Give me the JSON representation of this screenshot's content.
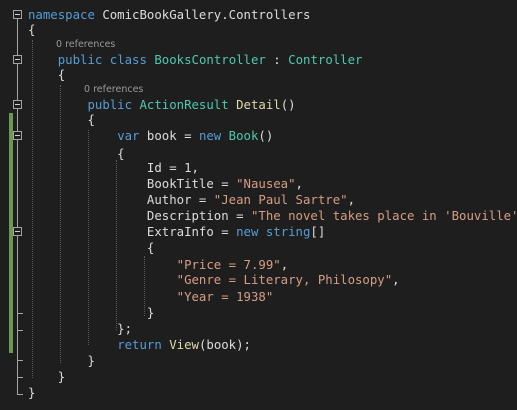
{
  "editor": {
    "language": "C#",
    "colors": {
      "background": "#1e1e1e",
      "keyword": "#569cd6",
      "type": "#4ec9b0",
      "method": "#dcdcaa",
      "string": "#d69d85",
      "plain": "#dcdcdc",
      "codelens": "#999999",
      "change_bar": "#6a9955"
    },
    "codelens": [
      {
        "label": "0 references"
      },
      {
        "label": "0 references"
      }
    ],
    "lines": [
      {
        "tokens": [
          {
            "t": "kw",
            "v": "namespace"
          },
          {
            "t": "pl",
            "v": " ComicBookGallery.Controllers"
          }
        ]
      },
      {
        "tokens": [
          {
            "t": "pl",
            "v": "{"
          }
        ]
      },
      {
        "tokens": [
          {
            "t": "pl",
            "v": "    "
          },
          {
            "t": "kw",
            "v": "public"
          },
          {
            "t": "pl",
            "v": " "
          },
          {
            "t": "kw",
            "v": "class"
          },
          {
            "t": "pl",
            "v": " "
          },
          {
            "t": "ty",
            "v": "BooksController"
          },
          {
            "t": "pl",
            "v": " : "
          },
          {
            "t": "ty",
            "v": "Controller"
          }
        ]
      },
      {
        "tokens": [
          {
            "t": "pl",
            "v": "    {"
          }
        ]
      },
      {
        "tokens": [
          {
            "t": "pl",
            "v": "        "
          },
          {
            "t": "kw",
            "v": "public"
          },
          {
            "t": "pl",
            "v": " "
          },
          {
            "t": "ty",
            "v": "ActionResult"
          },
          {
            "t": "pl",
            "v": " "
          },
          {
            "t": "fn",
            "v": "Detail"
          },
          {
            "t": "pl",
            "v": "()"
          }
        ]
      },
      {
        "tokens": [
          {
            "t": "pl",
            "v": "        {"
          }
        ]
      },
      {
        "tokens": [
          {
            "t": "pl",
            "v": "            "
          },
          {
            "t": "kw",
            "v": "var"
          },
          {
            "t": "pl",
            "v": " book = "
          },
          {
            "t": "kw",
            "v": "new"
          },
          {
            "t": "pl",
            "v": " "
          },
          {
            "t": "ty",
            "v": "Book"
          },
          {
            "t": "pl",
            "v": "()"
          }
        ]
      },
      {
        "tokens": [
          {
            "t": "pl",
            "v": "            {"
          }
        ]
      },
      {
        "tokens": [
          {
            "t": "pl",
            "v": "                Id = 1,"
          }
        ]
      },
      {
        "tokens": [
          {
            "t": "pl",
            "v": "                BookTitle = "
          },
          {
            "t": "str",
            "v": "\"Nausea\""
          },
          {
            "t": "pl",
            "v": ","
          }
        ]
      },
      {
        "tokens": [
          {
            "t": "pl",
            "v": "                Author = "
          },
          {
            "t": "str",
            "v": "\"Jean Paul Sartre\""
          },
          {
            "t": "pl",
            "v": ","
          }
        ]
      },
      {
        "tokens": [
          {
            "t": "pl",
            "v": "                Description = "
          },
          {
            "t": "str",
            "v": "\"The novel takes place in 'Bouville' (ho"
          }
        ]
      },
      {
        "tokens": [
          {
            "t": "pl",
            "v": "                ExtraInfo = "
          },
          {
            "t": "kw",
            "v": "new"
          },
          {
            "t": "pl",
            "v": " "
          },
          {
            "t": "kw",
            "v": "string"
          },
          {
            "t": "pl",
            "v": "[]"
          }
        ]
      },
      {
        "tokens": [
          {
            "t": "pl",
            "v": "                {"
          }
        ]
      },
      {
        "tokens": [
          {
            "t": "pl",
            "v": "                    "
          },
          {
            "t": "str",
            "v": "\"Price = 7.99\""
          },
          {
            "t": "pl",
            "v": ","
          }
        ]
      },
      {
        "tokens": [
          {
            "t": "pl",
            "v": "                    "
          },
          {
            "t": "str",
            "v": "\"Genre = Literary, Philosopy\""
          },
          {
            "t": "pl",
            "v": ","
          }
        ]
      },
      {
        "tokens": [
          {
            "t": "pl",
            "v": "                    "
          },
          {
            "t": "str",
            "v": "\"Year = 1938\""
          }
        ]
      },
      {
        "tokens": [
          {
            "t": "pl",
            "v": "                }"
          }
        ]
      },
      {
        "tokens": [
          {
            "t": "pl",
            "v": "            };"
          }
        ]
      },
      {
        "tokens": [
          {
            "t": "pl",
            "v": "            "
          },
          {
            "t": "kw",
            "v": "return"
          },
          {
            "t": "pl",
            "v": " "
          },
          {
            "t": "fn",
            "v": "View"
          },
          {
            "t": "pl",
            "v": "(book);"
          }
        ]
      },
      {
        "tokens": [
          {
            "t": "pl",
            "v": "        }"
          }
        ]
      },
      {
        "tokens": [
          {
            "t": "pl",
            "v": "    }"
          }
        ]
      },
      {
        "tokens": [
          {
            "t": "pl",
            "v": "}"
          }
        ]
      }
    ]
  }
}
